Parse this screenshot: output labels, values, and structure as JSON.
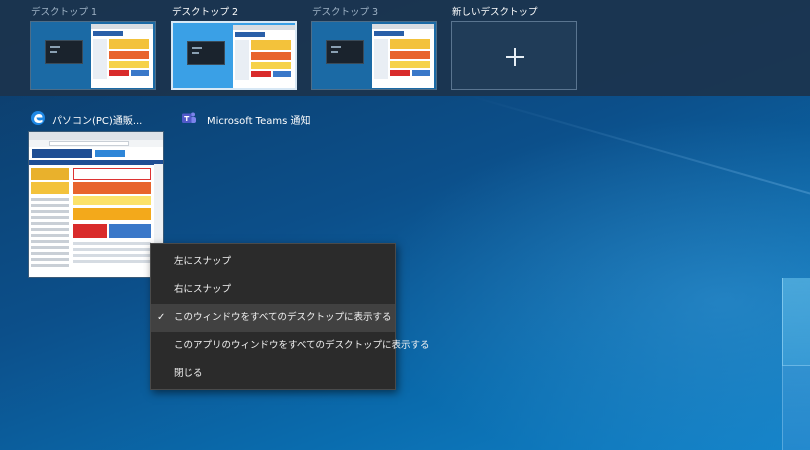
{
  "desktops": [
    {
      "label": "デスクトップ 1",
      "active": false
    },
    {
      "label": "デスクトップ 2",
      "active": true
    },
    {
      "label": "デスクトップ 3",
      "active": false
    }
  ],
  "new_desktop": {
    "label": "新しいデスクトップ",
    "icon": "plus-icon"
  },
  "windows": [
    {
      "title": "パソコン(PC)通販...",
      "icon": "edge-icon"
    },
    {
      "title": "Microsoft Teams 通知",
      "icon": "teams-icon"
    }
  ],
  "context_menu": {
    "items": [
      {
        "label": "左にスナップ",
        "checked": false
      },
      {
        "label": "右にスナップ",
        "checked": false
      },
      {
        "label": "このウィンドウをすべてのデスクトップに表示する",
        "checked": true
      },
      {
        "label": "このアプリのウィンドウをすべてのデスクトップに表示する",
        "checked": false
      },
      {
        "label": "閉じる",
        "checked": false
      }
    ],
    "check_glyph": "✓"
  },
  "colors": {
    "desk_bar": "#1c344e",
    "menu_bg": "#2b2b2b",
    "menu_highlight": "#414141",
    "accent_blue": "#3aa0e6"
  }
}
